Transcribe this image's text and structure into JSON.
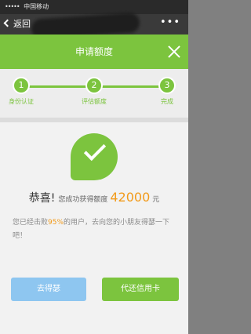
{
  "status_bar": {
    "carrier": "中国移动"
  },
  "wechat_bar": {
    "back_label": "返回"
  },
  "header": {
    "title": "申请额度"
  },
  "steps": [
    {
      "number": "1",
      "label": "身份认证"
    },
    {
      "number": "2",
      "label": "评估额度"
    },
    {
      "number": "3",
      "label": "完成"
    }
  ],
  "result": {
    "congrats": "恭喜!",
    "message": "您成功获得额度",
    "amount": "42000",
    "unit": "元",
    "desc_prefix": "您已经击败",
    "desc_percent": "95%",
    "desc_suffix": "的用户，去向您的小朋友得瑟一下吧！"
  },
  "buttons": {
    "share": "去得瑟",
    "repay": "代还信用卡"
  },
  "colors": {
    "accent_green": "#7cc43e",
    "highlight_orange": "#f29b1b",
    "share_blue": "#8ec6f0"
  }
}
